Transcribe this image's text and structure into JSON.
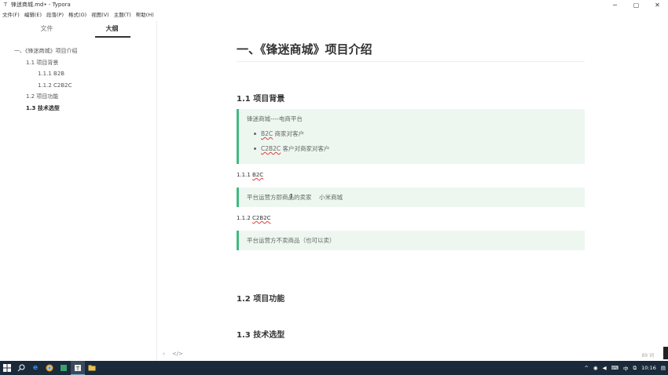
{
  "window": {
    "title": "锋迷商城.md• - Typora",
    "app_icon": "typora-icon",
    "minimize": "─",
    "maximize": "▢",
    "close": "✕"
  },
  "menu": [
    "文件(F)",
    "编辑(E)",
    "段落(P)",
    "格式(O)",
    "视图(V)",
    "主题(T)",
    "帮助(H)"
  ],
  "sidebar": {
    "tabs": [
      {
        "label": "文件",
        "active": false
      },
      {
        "label": "大纲",
        "active": true
      }
    ],
    "outline": [
      {
        "label": "一、《锋迷商城》项目介绍",
        "level": 1
      },
      {
        "label": "1.1 项目背景",
        "level": 2
      },
      {
        "label": "1.1.1 B2B",
        "level": 3
      },
      {
        "label": "1.1.2 C2B2C",
        "level": 3
      },
      {
        "label": "1.2 项目功能",
        "level": 2
      },
      {
        "label": "1.3 技术选型",
        "level": 2,
        "active": true
      }
    ]
  },
  "doc": {
    "h1": "一、《锋迷商城》项目介绍",
    "h2_background": "1.1 项目背景",
    "bq1_text": "锋迷商城----电商平台",
    "bq1_list": [
      {
        "term": "B2C",
        "rest": " 商家对客户"
      },
      {
        "term": "C2B2C",
        "rest": " 客户对商家对客户"
      }
    ],
    "h4_b2b_prefix": "1.1.1 ",
    "h4_b2b_term": "B2C",
    "bq2_text": "平台运营方即商品的卖家    小米商城",
    "h4_c2b2c_prefix": "1.1.2 ",
    "h4_c2b2c_term": "C2B2C",
    "bq3_text": "平台运营方不卖商品（也可以卖）",
    "h2_features": "1.2 项目功能",
    "h2_tech": "1.3 技术选型"
  },
  "footer": {
    "back": "‹",
    "source": "</>",
    "word_count": "89 词"
  },
  "taskbar": {
    "icons": [
      "windows-start-icon",
      "search-icon",
      "edge-icon",
      "chrome-icon",
      "app-icon",
      "typora-icon",
      "folder-icon"
    ],
    "tray": {
      "ime": "中",
      "time": "10:16"
    }
  }
}
